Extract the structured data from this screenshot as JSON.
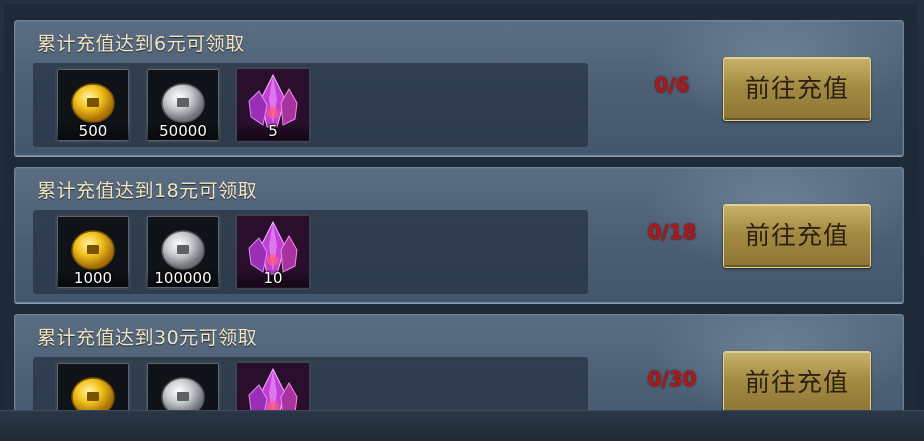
{
  "rewards_panel": {
    "tiers": [
      {
        "title": "累计充值达到6元可领取",
        "progress": "0/6",
        "button_label": "前往充值",
        "items": [
          {
            "icon": "gold-coin-icon",
            "count": "500"
          },
          {
            "icon": "silver-coin-icon",
            "count": "50000"
          },
          {
            "icon": "purple-crystal-icon",
            "count": "5"
          }
        ]
      },
      {
        "title": "累计充值达到18元可领取",
        "progress": "0/18",
        "button_label": "前往充值",
        "items": [
          {
            "icon": "gold-coin-icon",
            "count": "1000"
          },
          {
            "icon": "silver-coin-icon",
            "count": "100000"
          },
          {
            "icon": "purple-crystal-icon",
            "count": "10"
          }
        ]
      },
      {
        "title": "累计充值达到30元可领取",
        "progress": "0/30",
        "button_label": "前往充值",
        "items": [
          {
            "icon": "gold-coin-icon",
            "count": ""
          },
          {
            "icon": "silver-coin-icon",
            "count": ""
          },
          {
            "icon": "purple-crystal-icon",
            "count": ""
          }
        ]
      }
    ]
  },
  "colors": {
    "title_text": "#f1e4c0",
    "progress_text": "#b01818",
    "button_gold": "#a48b43"
  }
}
